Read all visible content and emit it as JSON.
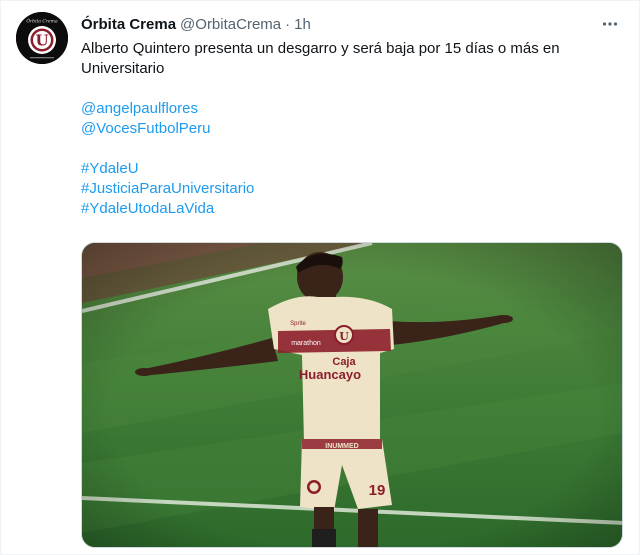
{
  "tweet": {
    "author_name": "Órbita Crema",
    "author_handle": "@OrbitaCrema",
    "separator": "·",
    "time": "1h",
    "text": "Alberto Quintero presenta un desgarro y será baja por 15 días o más en Universitario",
    "text_line1": "Alberto Quintero presenta un desgarro y será baja por 15 días o más en",
    "text_line2": "Universitario",
    "mentions": [
      "@angelpaulflores",
      "@VocesFutbolPeru"
    ],
    "hashtags": [
      "#YdaleU",
      "#JusticiaParaUniversitario",
      "#YdaleUtodaLaVida"
    ],
    "more_icon": "more-horizontal-icon"
  },
  "avatar": {
    "logo_letter": "U",
    "logo_caption": "Órbita Crema"
  },
  "media": {
    "jersey_sponsor_line1": "Caja",
    "jersey_sponsor_line2": "Huancayo",
    "jersey_number": "19",
    "jersey_text_marathon": "marathon",
    "jersey_text_spriter": "Sprite",
    "shorts_text": "INUMMED",
    "colors": {
      "pitch_light": "#4f8a3e",
      "pitch_dark": "#2f6b2c",
      "jersey": "#efe3c7",
      "stripe": "#8b1e2a"
    }
  },
  "colors": {
    "link": "#1d9bf0",
    "muted": "#536471",
    "text": "#0f1419"
  }
}
